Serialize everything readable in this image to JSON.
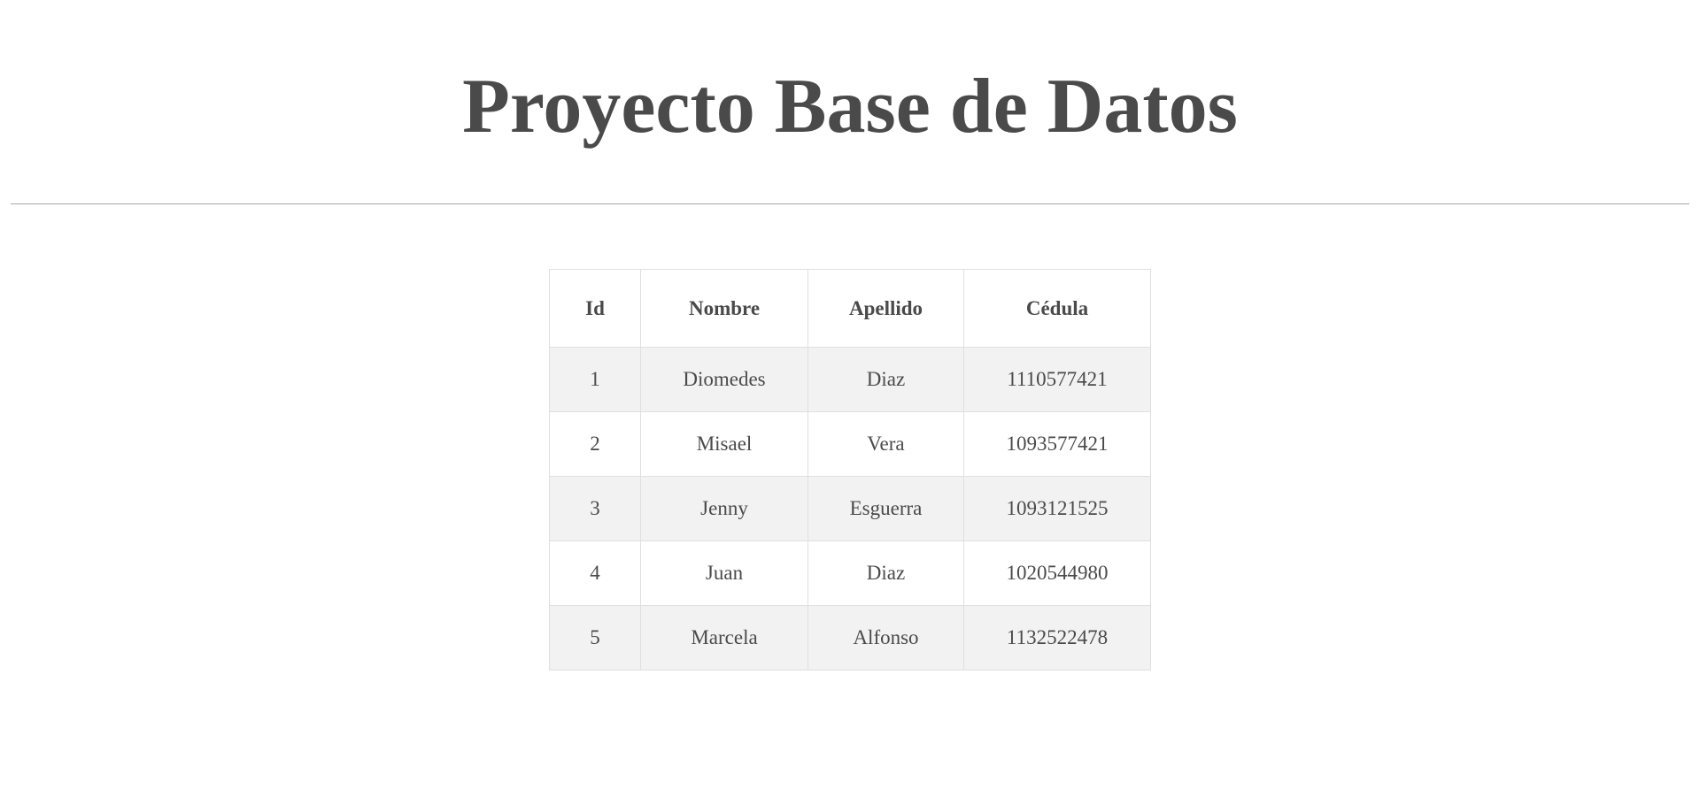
{
  "page": {
    "title": "Proyecto Base de Datos"
  },
  "table": {
    "headers": {
      "id": "Id",
      "nombre": "Nombre",
      "apellido": "Apellido",
      "cedula": "Cédula"
    },
    "rows": [
      {
        "id": "1",
        "nombre": "Diomedes",
        "apellido": "Diaz",
        "cedula": "1110577421"
      },
      {
        "id": "2",
        "nombre": "Misael",
        "apellido": "Vera",
        "cedula": "1093577421"
      },
      {
        "id": "3",
        "nombre": "Jenny",
        "apellido": "Esguerra",
        "cedula": "1093121525"
      },
      {
        "id": "4",
        "nombre": "Juan",
        "apellido": "Diaz",
        "cedula": "1020544980"
      },
      {
        "id": "5",
        "nombre": "Marcela",
        "apellido": "Alfonso",
        "cedula": "1132522478"
      }
    ]
  },
  "colors": {
    "text": "#4a4a4a",
    "stripe": "#f2f2f2",
    "border": "#e0e0e0",
    "divider": "#a9a9a9"
  }
}
